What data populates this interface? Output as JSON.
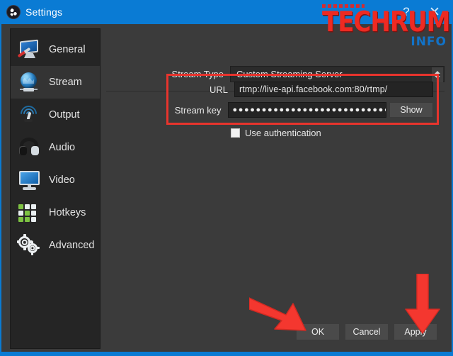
{
  "window": {
    "title": "Settings",
    "app_icon": "obs-logo-icon",
    "help_button": "?",
    "close_button": "✕",
    "titlebar_color": "#0a7bd4",
    "body_color": "#3b3b3b"
  },
  "watermark": {
    "main": "TECHRUM",
    "sub": "INFO",
    "main_color": "#ee2a22",
    "sub_color": "#1173c9"
  },
  "sidebar": {
    "items": [
      {
        "label": "General",
        "icon": "monitor-screwdriver-icon",
        "selected": false
      },
      {
        "label": "Stream",
        "icon": "globe-icon",
        "selected": true
      },
      {
        "label": "Output",
        "icon": "broadcast-waves-icon",
        "selected": false
      },
      {
        "label": "Audio",
        "icon": "headset-icon",
        "selected": false
      },
      {
        "label": "Video",
        "icon": "monitor-icon",
        "selected": false
      },
      {
        "label": "Hotkeys",
        "icon": "keyboard-icon",
        "selected": false
      },
      {
        "label": "Advanced",
        "icon": "gears-icon",
        "selected": false
      }
    ]
  },
  "main": {
    "stream_type": {
      "label": "Stream Type",
      "value": "Custom Streaming Server",
      "spinner_icon": "updown-spinner-icon"
    },
    "url": {
      "label": "URL",
      "value": "rtmp://live-api.facebook.com:80/rtmp/"
    },
    "stream_key": {
      "label": "Stream key",
      "value": "●●●●●●●●●●●●●●●●●●●●●●●●●●●●●●",
      "show_button": "Show"
    },
    "use_authentication": {
      "label": "Use authentication",
      "checked": false
    },
    "highlight_color": "#e8342d"
  },
  "footer": {
    "ok": "OK",
    "cancel": "Cancel",
    "apply": "Apply"
  },
  "annotations": {
    "arrow_color": "#f4372f",
    "arrow_to_ok": "red-arrow-pointing-to-ok",
    "arrow_to_apply": "red-arrow-pointing-to-apply"
  }
}
